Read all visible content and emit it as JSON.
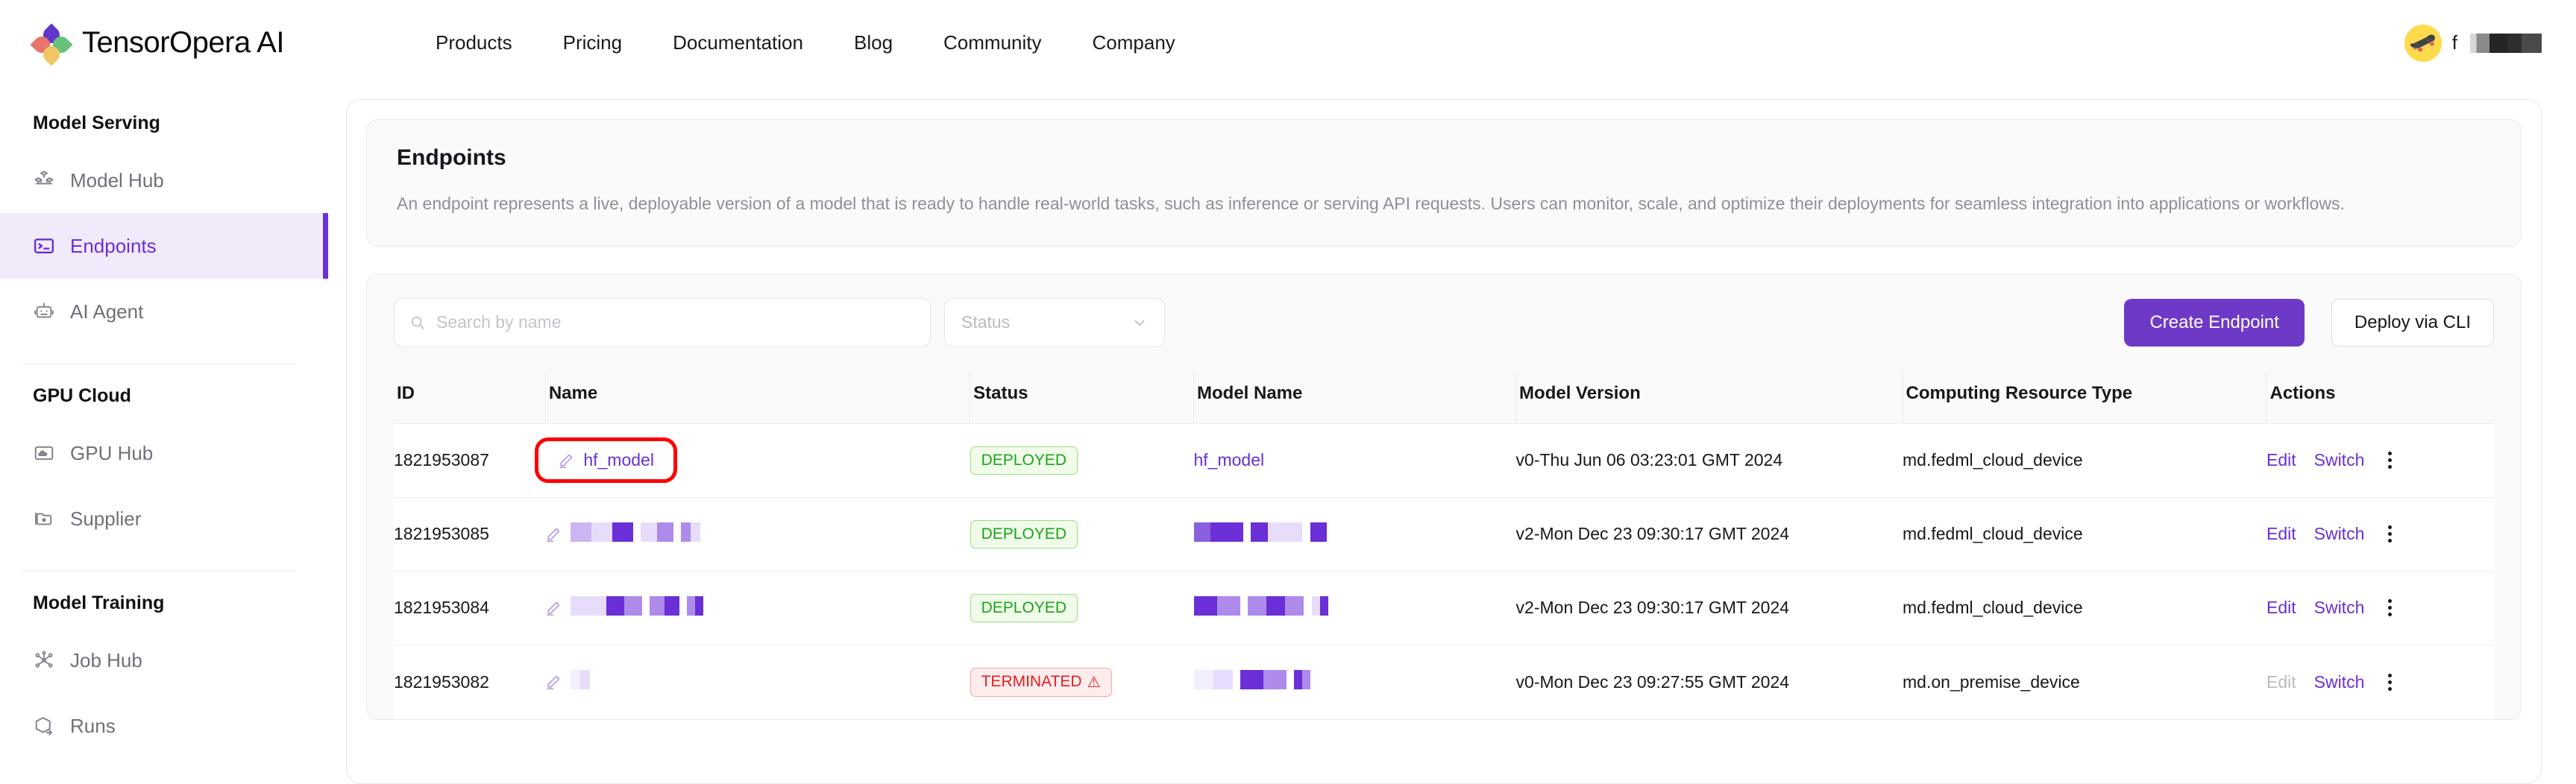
{
  "brand": {
    "name": "TensorOpera AI",
    "logo_icon": "flower-logo-icon"
  },
  "nav": {
    "links": [
      "Products",
      "Pricing",
      "Documentation",
      "Blog",
      "Community",
      "Company"
    ]
  },
  "user": {
    "avatar_icon": "skateboard-avatar",
    "avatar_glyph": "🛹",
    "name_initial": "f",
    "name_redacted": true
  },
  "sidebar": {
    "groups": [
      {
        "title": "Model Serving",
        "items": [
          {
            "label": "Model Hub",
            "icon": "cubes-icon",
            "active": false
          },
          {
            "label": "Endpoints",
            "icon": "terminal-icon",
            "active": true
          },
          {
            "label": "AI Agent",
            "icon": "robot-icon",
            "active": false
          }
        ]
      },
      {
        "title": "GPU Cloud",
        "items": [
          {
            "label": "GPU Hub",
            "icon": "cloud-image-icon",
            "active": false
          },
          {
            "label": "Supplier",
            "icon": "folders-icon",
            "active": false
          }
        ]
      },
      {
        "title": "Model Training",
        "items": [
          {
            "label": "Job Hub",
            "icon": "network-nodes-icon",
            "active": false
          },
          {
            "label": "Runs",
            "icon": "cube-arrow-icon",
            "active": false
          }
        ]
      }
    ]
  },
  "page": {
    "title": "Endpoints",
    "description": "An endpoint represents a live, deployable version of a model that is ready to handle real-world tasks, such as inference or serving API requests. Users can monitor, scale, and optimize their deployments for seamless integration into applications or workflows."
  },
  "toolbar": {
    "search_placeholder": "Search by name",
    "search_value": "",
    "search_icon": "search-icon",
    "status_label": "Status",
    "status_chevron_icon": "chevron-down-icon",
    "create_endpoint_label": "Create Endpoint",
    "deploy_cli_label": "Deploy via CLI"
  },
  "table": {
    "columns": [
      "ID",
      "Name",
      "Status",
      "Model Name",
      "Model Version",
      "Computing Resource Type",
      "Actions"
    ],
    "rows": [
      {
        "id": "1821953087",
        "name": "hf_model",
        "name_redacted": false,
        "name_highlighted": true,
        "edit_icon": "pencil-icon",
        "status": "DEPLOYED",
        "status_type": "deployed",
        "model_name": "hf_model",
        "model_name_redacted": false,
        "model_version": "v0-Thu Jun 06 03:23:01 GMT 2024",
        "resource_type": "md.fedml_cloud_device",
        "actions": {
          "edit": "Edit",
          "edit_disabled": false,
          "switch": "Switch",
          "more_icon": "kebab-menu-icon"
        }
      },
      {
        "id": "1821953085",
        "name": "",
        "name_redacted": true,
        "name_highlighted": false,
        "edit_icon": "pencil-icon",
        "status": "DEPLOYED",
        "status_type": "deployed",
        "model_name": "",
        "model_name_redacted": true,
        "model_version": "v2-Mon Dec 23 09:30:17 GMT 2024",
        "resource_type": "md.fedml_cloud_device",
        "actions": {
          "edit": "Edit",
          "edit_disabled": false,
          "switch": "Switch",
          "more_icon": "kebab-menu-icon"
        }
      },
      {
        "id": "1821953084",
        "name": "",
        "name_redacted": true,
        "name_highlighted": false,
        "edit_icon": "pencil-icon",
        "status": "DEPLOYED",
        "status_type": "deployed",
        "model_name": "",
        "model_name_redacted": true,
        "model_version": "v2-Mon Dec 23 09:30:17 GMT 2024",
        "resource_type": "md.fedml_cloud_device",
        "actions": {
          "edit": "Edit",
          "edit_disabled": false,
          "switch": "Switch",
          "more_icon": "kebab-menu-icon"
        }
      },
      {
        "id": "1821953082",
        "name": "",
        "name_redacted": true,
        "name_highlighted": false,
        "edit_icon": "pencil-icon",
        "status": "TERMINATED",
        "status_type": "terminated",
        "status_warning_icon": "warning-triangle-icon",
        "model_name": "",
        "model_name_redacted": true,
        "model_version": "v0-Mon Dec 23 09:27:55 GMT 2024",
        "resource_type": "md.on_premise_device",
        "actions": {
          "edit": "Edit",
          "edit_disabled": true,
          "switch": "Switch",
          "more_icon": "kebab-menu-icon"
        }
      }
    ]
  },
  "colors": {
    "accent_purple": "#6A2FD6",
    "button_purple": "#6F39C7",
    "deployed_green": "#1BA51B",
    "terminated_red": "#E02020",
    "highlight_red": "#FF0000",
    "sidebar_active_bg": "#F1EAFB"
  }
}
